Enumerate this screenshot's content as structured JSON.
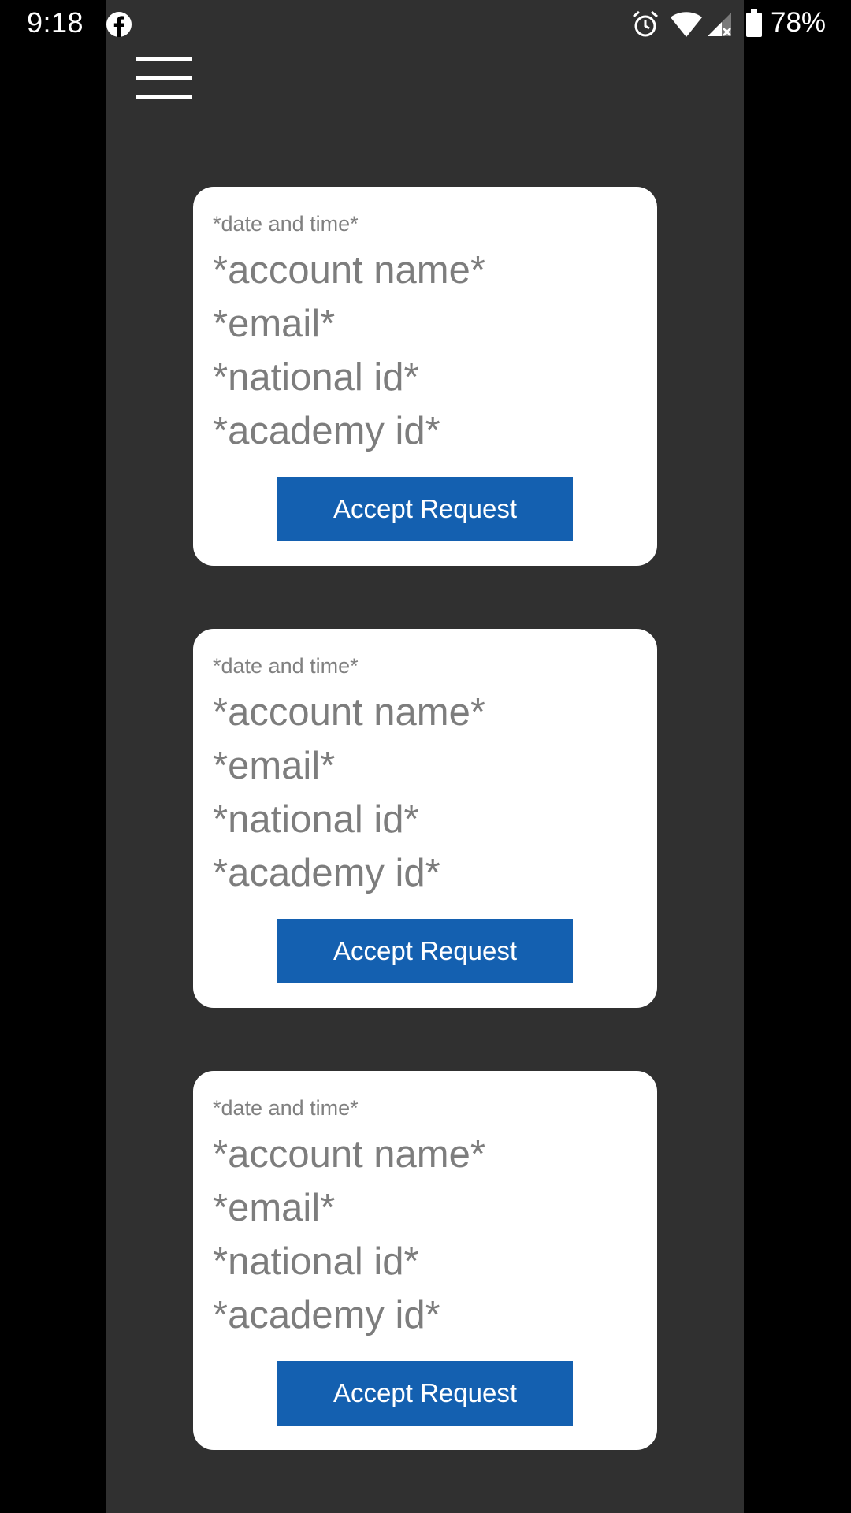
{
  "status_bar": {
    "time": "9:18",
    "battery": "78%",
    "icons": [
      "facebook-icon",
      "alarm-icon",
      "wifi-icon",
      "signal-icon",
      "battery-icon"
    ]
  },
  "menu": {
    "icon": "hamburger-menu-icon"
  },
  "colors": {
    "app_background": "#303030",
    "card_background": "#ffffff",
    "button_background": "#1460b0",
    "placeholder_text": "#7d7d7d"
  },
  "requests": [
    {
      "date_time": "*date and time*",
      "account_name": "*account name*",
      "email": "*email*",
      "national_id": "*national id*",
      "academy_id": "*academy id*",
      "accept_label": "Accept Request"
    },
    {
      "date_time": "*date and time*",
      "account_name": "*account name*",
      "email": "*email*",
      "national_id": "*national id*",
      "academy_id": "*academy id*",
      "accept_label": "Accept Request"
    },
    {
      "date_time": "*date and time*",
      "account_name": "*account name*",
      "email": "*email*",
      "national_id": "*national id*",
      "academy_id": "*academy id*",
      "accept_label": "Accept Request"
    }
  ]
}
